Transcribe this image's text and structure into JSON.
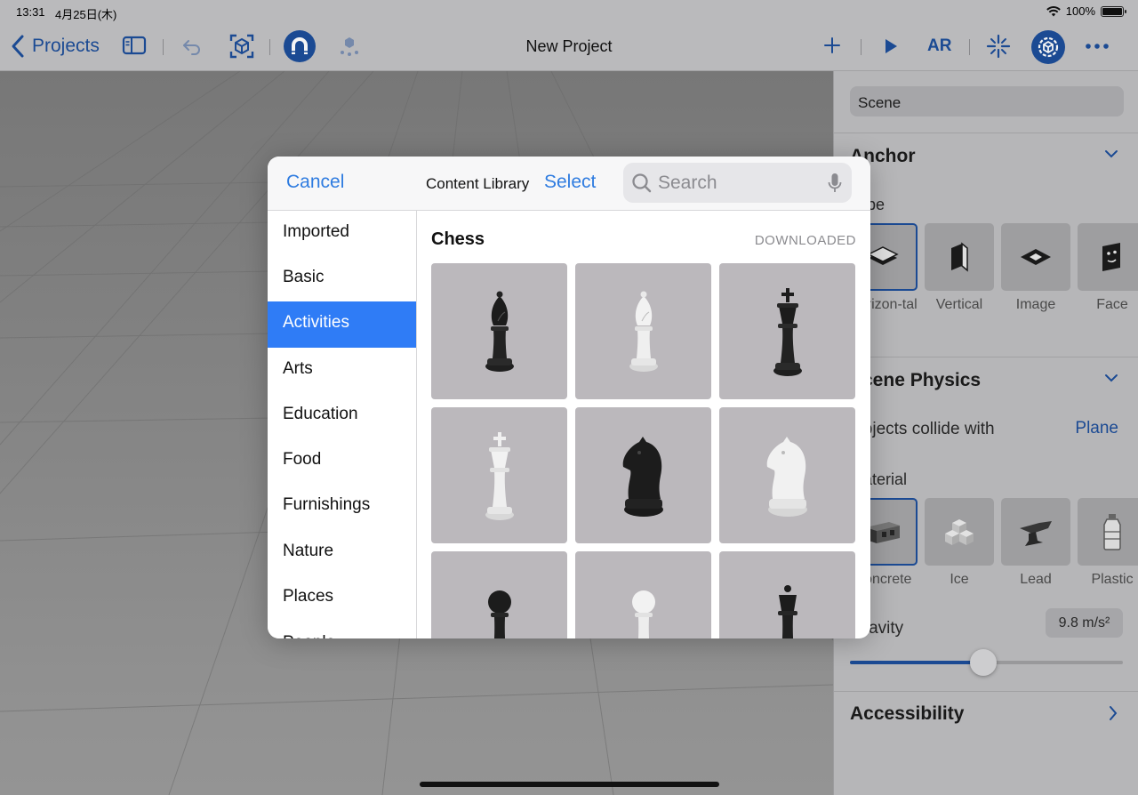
{
  "status_bar": {
    "time": "13:31",
    "date": "4月25日(木)",
    "battery": "100%"
  },
  "toolbar": {
    "back_label": "Projects",
    "title": "New Project",
    "ar_label": "AR"
  },
  "inspector": {
    "scene_field": "Scene",
    "anchor": {
      "title": "Anchor",
      "type_label": "Type",
      "types": [
        {
          "label": "Horizon-tal",
          "icon": "horizontal-plane-icon",
          "selected": true
        },
        {
          "label": "Vertical",
          "icon": "vertical-plane-icon",
          "selected": false
        },
        {
          "label": "Image",
          "icon": "image-anchor-icon",
          "selected": false
        },
        {
          "label": "Face",
          "icon": "face-anchor-icon",
          "selected": false
        }
      ]
    },
    "physics": {
      "title": "Scene Physics",
      "collide_label": "Objects collide with",
      "collide_value": "Plane",
      "material_label": "Material",
      "materials": [
        {
          "label": "Concrete",
          "icon": "concrete-icon",
          "selected": true
        },
        {
          "label": "Ice",
          "icon": "ice-icon",
          "selected": false
        },
        {
          "label": "Lead",
          "icon": "lead-icon",
          "selected": false
        },
        {
          "label": "Plastic",
          "icon": "plastic-icon",
          "selected": false
        }
      ],
      "gravity_label": "Gravity",
      "gravity_value": "9.8 m/s²",
      "gravity_slider_fraction": 0.49
    },
    "accessibility_title": "Accessibility"
  },
  "modal": {
    "cancel": "Cancel",
    "title": "Content Library",
    "select": "Select",
    "search_placeholder": "Search",
    "categories": [
      "Imported",
      "Basic",
      "Activities",
      "Arts",
      "Education",
      "Food",
      "Furnishings",
      "Nature",
      "Places",
      "People"
    ],
    "selected_category": "Activities",
    "section_title": "Chess",
    "section_status": "DOWNLOADED",
    "items": [
      {
        "name": "black-bishop",
        "color": "#1f1f1f"
      },
      {
        "name": "white-bishop",
        "color": "#e8e8e8"
      },
      {
        "name": "black-king",
        "color": "#1f1f1f"
      },
      {
        "name": "white-king",
        "color": "#e8e8e8"
      },
      {
        "name": "black-knight",
        "color": "#1f1f1f"
      },
      {
        "name": "white-knight",
        "color": "#e8e8e8"
      },
      {
        "name": "black-pawn",
        "color": "#1f1f1f"
      },
      {
        "name": "white-pawn",
        "color": "#e8e8e8"
      },
      {
        "name": "black-queen",
        "color": "#1f1f1f"
      }
    ]
  },
  "colors": {
    "accent": "#2f7cf6",
    "toolbar_icon": "#1d4e9a"
  }
}
